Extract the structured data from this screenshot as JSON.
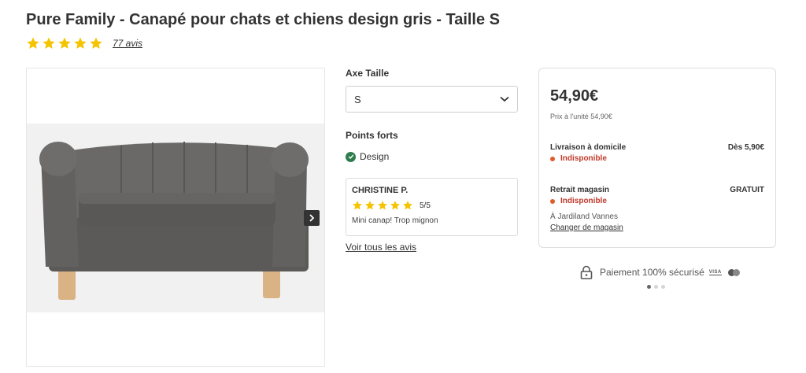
{
  "product": {
    "title": "Pure Family - Canapé pour chats et chiens design gris - Taille S",
    "rating_value": 5,
    "rating_max": 5,
    "reviews_link": "77 avis",
    "image_alt": "sofa"
  },
  "options": {
    "size_label": "Axe Taille",
    "size_value": "S"
  },
  "highlights": {
    "label": "Points forts",
    "items": [
      "Design"
    ]
  },
  "review": {
    "author": "CHRISTINE P.",
    "stars": 5,
    "score": "5/5",
    "text": "Mini canap! Trop mignon",
    "all_link": "Voir tous les avis"
  },
  "pricing": {
    "price": "54,90€",
    "unit_price": "Prix à l'unité 54,90€",
    "delivery": {
      "title": "Livraison à domicile",
      "value": "Dès 5,90€",
      "status": "Indisponible"
    },
    "pickup": {
      "title": "Retrait magasin",
      "value": "GRATUIT",
      "status": "Indisponible",
      "store": "À Jardiland Vannes",
      "change_link": "Changer de magasin"
    }
  },
  "payment": {
    "text": "Paiement 100% sécurisé",
    "visa": "VISA"
  },
  "carousel": {
    "pages": 3,
    "active": 1
  },
  "colors": {
    "star": "#f5c400",
    "check": "#2e7d4f",
    "unavailable": "#e05a2a"
  }
}
